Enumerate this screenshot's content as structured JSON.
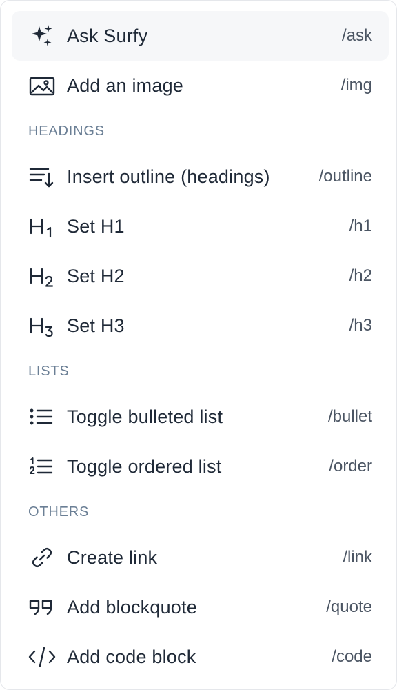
{
  "menu": {
    "items": [
      {
        "label": "Ask Surfy",
        "shortcut": "/ask",
        "icon": "sparkles-icon"
      },
      {
        "label": "Add an image",
        "shortcut": "/img",
        "icon": "image-icon"
      }
    ],
    "sections": {
      "headings": {
        "title": "HEADINGS",
        "items": [
          {
            "label": "Insert outline (headings)",
            "shortcut": "/outline",
            "icon": "outline-icon"
          },
          {
            "label": "Set H1",
            "shortcut": "/h1",
            "icon": "heading-1-icon"
          },
          {
            "label": "Set H2",
            "shortcut": "/h2",
            "icon": "heading-2-icon"
          },
          {
            "label": "Set H3",
            "shortcut": "/h3",
            "icon": "heading-3-icon"
          }
        ]
      },
      "lists": {
        "title": "LISTS",
        "items": [
          {
            "label": "Toggle bulleted list",
            "shortcut": "/bullet",
            "icon": "bulleted-list-icon"
          },
          {
            "label": "Toggle ordered list",
            "shortcut": "/order",
            "icon": "ordered-list-icon"
          }
        ]
      },
      "others": {
        "title": "OTHERS",
        "items": [
          {
            "label": "Create link",
            "shortcut": "/link",
            "icon": "link-icon"
          },
          {
            "label": "Add blockquote",
            "shortcut": "/quote",
            "icon": "quote-icon"
          },
          {
            "label": "Add code block",
            "shortcut": "/code",
            "icon": "code-icon"
          }
        ]
      }
    }
  },
  "colors": {
    "text": "#1f2937",
    "shortcut": "#4b5563",
    "section": "#6b7f95",
    "active_bg": "#f6f7f9"
  }
}
